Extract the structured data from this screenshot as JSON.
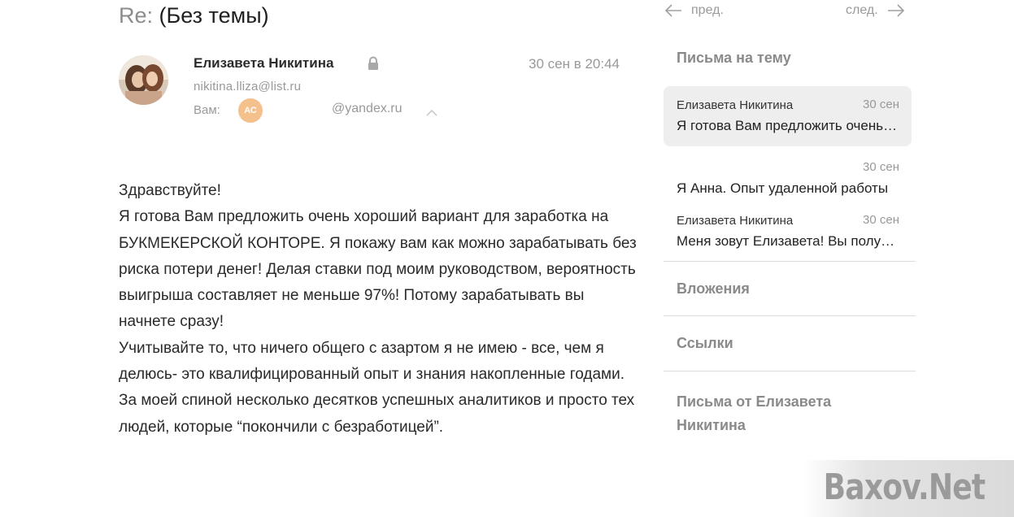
{
  "message": {
    "subject_prefix": "Re:",
    "subject": "(Без темы)",
    "sender_name": "Елизавета Никитина",
    "sender_email": "nikitina.lliza@list.ru",
    "date": "30 сен в 20:44",
    "to_label": "Вам:",
    "recipient_initials": "АС",
    "recipient_email": "@yandex.ru",
    "body": [
      "Здравствуйте!",
      "Я готова Вам предложить очень хороший вариант для заработка на БУКМЕКЕРСКОЙ КОНТОРЕ. Я покажу вам как можно зарабатывать без риска потери денег! Делая ставки под моим руководством, вероятность выигрыша составляет не меньше 97%! Потому зарабатывать вы начнете сразу!",
      "Учитывайте то, что ничего общего с азартом я не имею - все, чем я делюсь- это квалифицированный опыт и знания накопленные годами.",
      "За моей спиной несколько десятков успешных аналитиков и просто тех людей, которые “покончили с безработицей”."
    ]
  },
  "nav": {
    "prev_label": "пред.",
    "next_label": "след."
  },
  "sidebar": {
    "thread_title": "Письма на тему",
    "threads": [
      {
        "sender": "Елизавета Никитина",
        "date": "30 сен",
        "snippet": "Я готова Вам предложить очень хороший вариант",
        "active": true
      },
      {
        "sender": "",
        "date": "30 сен",
        "snippet": "Я Анна. Опыт удаленной работы",
        "active": false
      },
      {
        "sender": "Елизавета Никитина",
        "date": "30 сен",
        "snippet": "Меня зовут Елизавета! Вы получили",
        "active": false
      }
    ],
    "attachments_label": "Вложения",
    "links_label": "Ссылки",
    "from_sender_label": "Письма от Елизавета Никитина"
  },
  "watermark": "Baxov.Net",
  "colors": {
    "badge": "#f4c08c",
    "active_card": "#eeeeee",
    "muted_text": "#999999"
  }
}
